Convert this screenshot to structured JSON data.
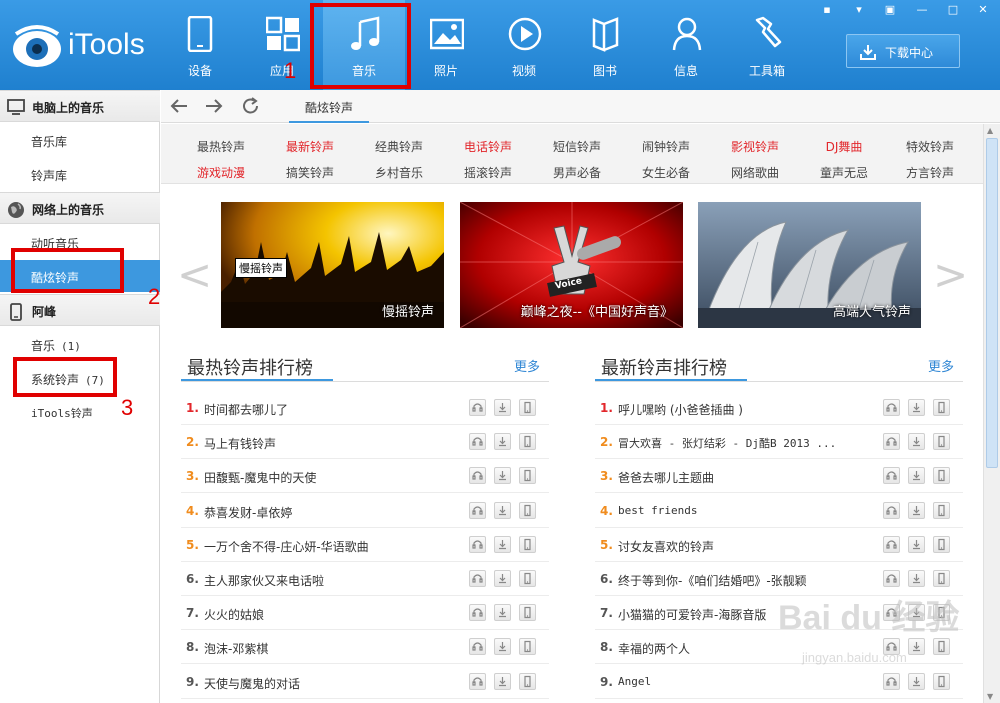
{
  "app": {
    "name": "iTools"
  },
  "nav": [
    {
      "label": "设备",
      "icon": "device-icon"
    },
    {
      "label": "应用",
      "icon": "apps-icon"
    },
    {
      "label": "音乐",
      "icon": "music-note-icon"
    },
    {
      "label": "照片",
      "icon": "photo-icon"
    },
    {
      "label": "视频",
      "icon": "video-play-icon"
    },
    {
      "label": "图书",
      "icon": "book-icon"
    },
    {
      "label": "信息",
      "icon": "person-icon"
    },
    {
      "label": "工具箱",
      "icon": "wrench-icon"
    }
  ],
  "download_center": {
    "label": "下载中心"
  },
  "sidebar": {
    "sections": [
      {
        "title": "电脑上的音乐",
        "icon": "monitor-icon",
        "items": [
          {
            "label": "音乐库",
            "count": ""
          },
          {
            "label": "铃声库",
            "count": ""
          }
        ]
      },
      {
        "title": "网络上的音乐",
        "icon": "globe-icon",
        "items": [
          {
            "label": "动听音乐",
            "count": ""
          },
          {
            "label": "酷炫铃声",
            "count": ""
          }
        ]
      },
      {
        "title": "阿峰",
        "icon": "phone-icon",
        "items": [
          {
            "label": "音乐",
            "count": "(1)"
          },
          {
            "label": "系统铃声",
            "count": "(7)"
          },
          {
            "label": "iTools铃声",
            "count": ""
          }
        ]
      }
    ]
  },
  "toolbar": {
    "tab": "酷炫铃声"
  },
  "categories": {
    "row1": [
      "最热铃声",
      "最新铃声",
      "经典铃声",
      "电话铃声",
      "短信铃声",
      "闹钟铃声",
      "影视铃声",
      "DJ舞曲",
      "特效铃声"
    ],
    "row2": [
      "游戏动漫",
      "搞笑铃声",
      "乡村音乐",
      "摇滚铃声",
      "男声必备",
      "女生必备",
      "网络歌曲",
      "童声无忌",
      "方言铃声"
    ]
  },
  "banners": [
    {
      "caption": "慢摇铃声",
      "tag": "慢摇铃声"
    },
    {
      "caption": "巅峰之夜--《中国好声音》",
      "tag": "Voice"
    },
    {
      "caption": "高端大气铃声",
      "tag": ""
    }
  ],
  "hot_list": {
    "title": "最热铃声排行榜",
    "more": "更多",
    "items": [
      {
        "num": "1.",
        "title": "时间都去哪儿了"
      },
      {
        "num": "2.",
        "title": "马上有钱铃声"
      },
      {
        "num": "3.",
        "title": "田馥甄-魔鬼中的天使"
      },
      {
        "num": "4.",
        "title": "恭喜发财-卓依婷"
      },
      {
        "num": "5.",
        "title": "一万个舍不得-庄心妍-华语歌曲"
      },
      {
        "num": "6.",
        "title": "主人那家伙又来电话啦"
      },
      {
        "num": "7.",
        "title": "火火的姑娘"
      },
      {
        "num": "8.",
        "title": "泡沫-邓紫棋"
      },
      {
        "num": "9.",
        "title": "天使与魔鬼的对话"
      }
    ]
  },
  "new_list": {
    "title": "最新铃声排行榜",
    "more": "更多",
    "items": [
      {
        "num": "1.",
        "title": "呼儿嘿哟 (小爸爸插曲 )"
      },
      {
        "num": "2.",
        "title": "冒大欢喜 - 张灯结彩 - Dj酷B 2013 ..."
      },
      {
        "num": "3.",
        "title": "爸爸去哪儿主题曲"
      },
      {
        "num": "4.",
        "title": "best friends"
      },
      {
        "num": "5.",
        "title": "讨女友喜欢的铃声"
      },
      {
        "num": "6.",
        "title": "终于等到你-《咱们结婚吧》-张靓颖"
      },
      {
        "num": "7.",
        "title": "小猫猫的可爱铃声-海豚音版"
      },
      {
        "num": "8.",
        "title": "幸福的两个人"
      },
      {
        "num": "9.",
        "title": "Angel"
      }
    ]
  },
  "annotations": [
    "1",
    "2",
    "3"
  ],
  "watermark": {
    "big": "Bai du 经验",
    "small": "jingyan.baidu.com"
  },
  "colors": {
    "accent": "#3d98df",
    "hot_red": "#e2262b",
    "annotation_red": "#e00000",
    "topbar": "#2a8cdb"
  }
}
